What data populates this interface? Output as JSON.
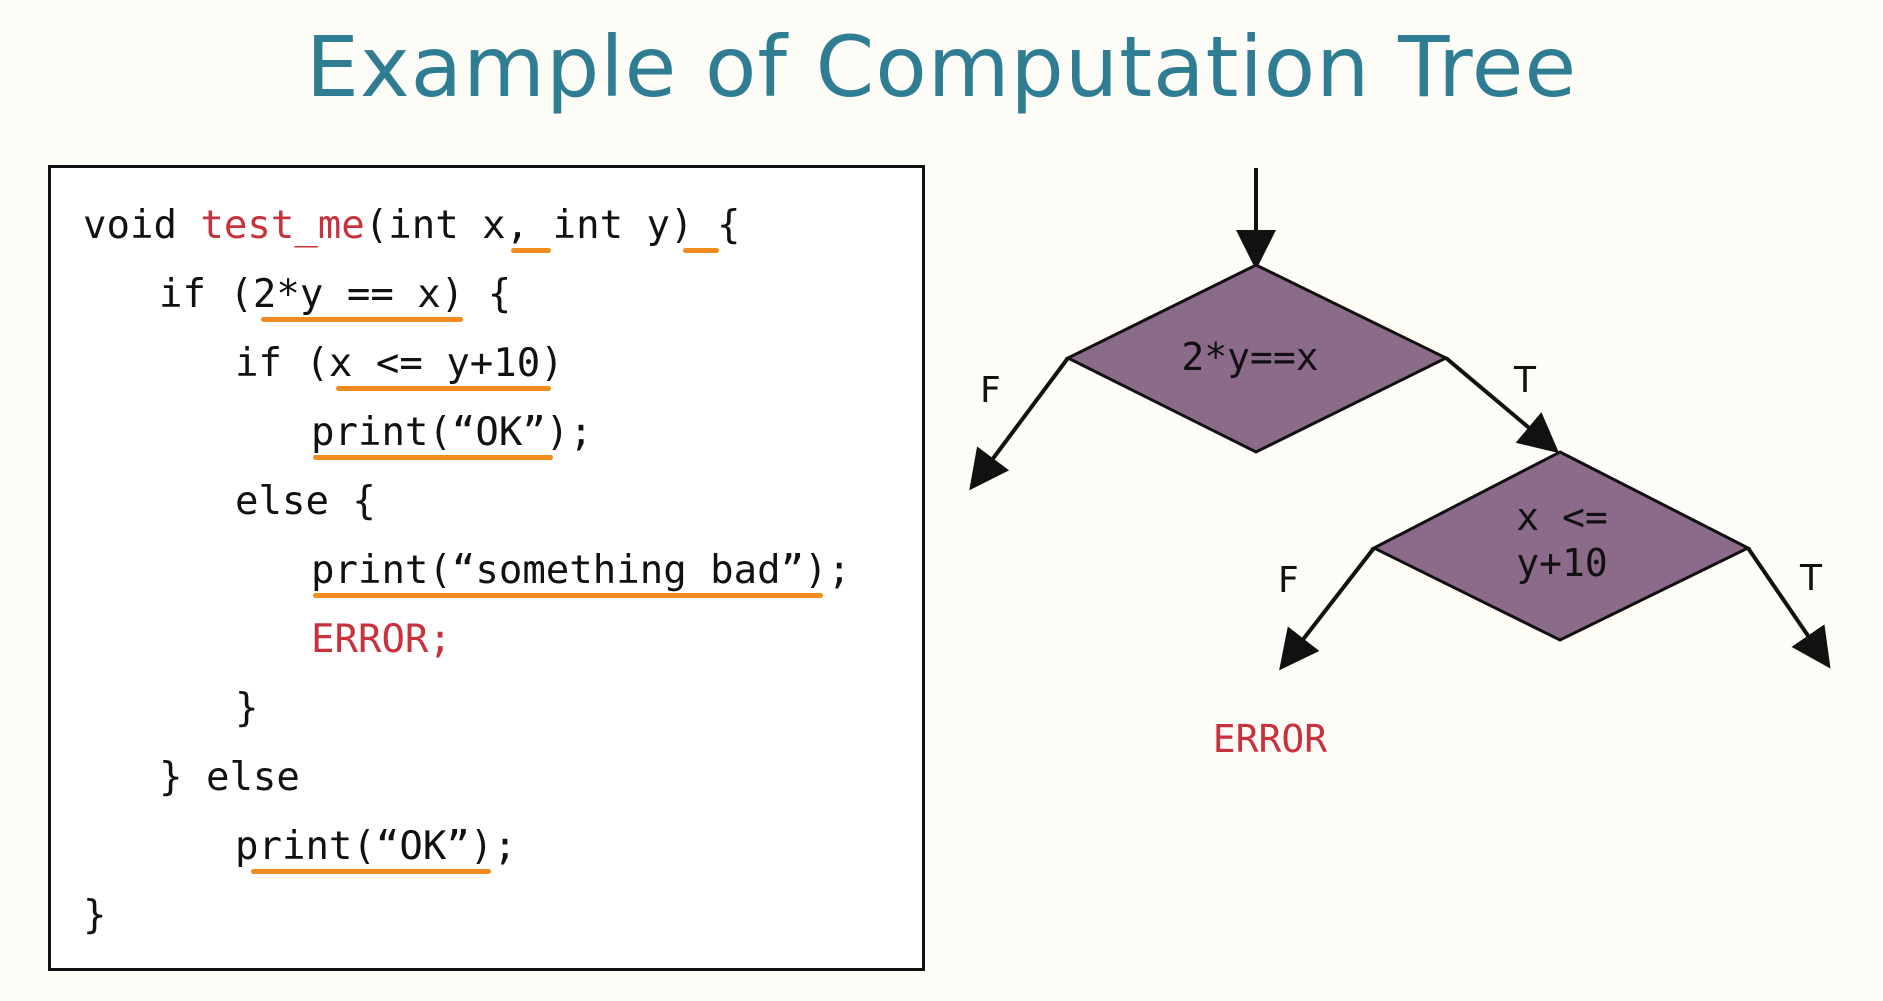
{
  "title": "Example of Computation Tree",
  "code": {
    "lines": [
      {
        "indent": "",
        "before": "void ",
        "red": "test_me",
        "after": "(int x, int y) {"
      },
      {
        "indent": "   ",
        "before": "if (2*y == x) {",
        "red": "",
        "after": ""
      },
      {
        "indent": "      ",
        "before": "if (x <= y+10)",
        "red": "",
        "after": ""
      },
      {
        "indent": "         ",
        "before": "print(“OK”);",
        "red": "",
        "after": ""
      },
      {
        "indent": "      ",
        "before": "else {",
        "red": "",
        "after": ""
      },
      {
        "indent": "         ",
        "before": "print(“something bad”);",
        "red": "",
        "after": ""
      },
      {
        "indent": "         ",
        "before": "",
        "red": "ERROR;",
        "after": ""
      },
      {
        "indent": "      ",
        "before": "}",
        "red": "",
        "after": ""
      },
      {
        "indent": "   ",
        "before": "} else",
        "red": "",
        "after": ""
      },
      {
        "indent": "      ",
        "before": "print(“OK”);",
        "red": "",
        "after": ""
      },
      {
        "indent": "",
        "before": "}",
        "red": "",
        "after": ""
      }
    ]
  },
  "tree": {
    "node1_label": "2*y==x",
    "node2_label_line1": "x <=",
    "node2_label_line2": "y+10",
    "false_label": "F",
    "true_label": "T",
    "error_label": "ERROR"
  },
  "colors": {
    "title": "#2f7d93",
    "highlight_red": "#c8323c",
    "underline_orange": "#f28a1e",
    "node_fill": "#8b6a8a"
  }
}
